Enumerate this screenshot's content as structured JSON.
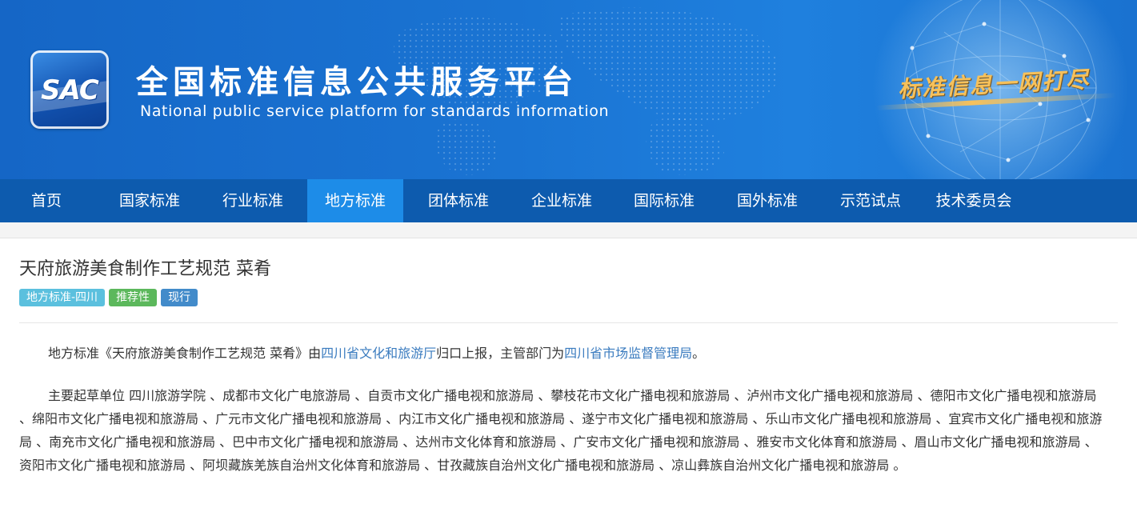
{
  "header": {
    "logo_text": "SAC",
    "title": "全国标准信息公共服务平台",
    "subtitle": "National public service platform  for standards information",
    "slogan": "标准信息一网打尽"
  },
  "nav": {
    "items": [
      {
        "label": "首页"
      },
      {
        "label": "国家标准"
      },
      {
        "label": "行业标准"
      },
      {
        "label": "地方标准"
      },
      {
        "label": "团体标准"
      },
      {
        "label": "企业标准"
      },
      {
        "label": "国际标准"
      },
      {
        "label": "国外标准"
      },
      {
        "label": "示范试点"
      },
      {
        "label": "技术委员会"
      }
    ],
    "active": "地方标准"
  },
  "standard": {
    "title": "天府旅游美食制作工艺规范 菜肴",
    "badges": [
      {
        "label": "地方标准-四川",
        "color": "#5bc0de"
      },
      {
        "label": "推荐性",
        "color": "#5cb85c"
      },
      {
        "label": "现行",
        "color": "#428bca"
      }
    ],
    "summary": {
      "prefix": "地方标准《天府旅游美食制作工艺规范 菜肴》由",
      "reporter": "四川省文化和旅游厅",
      "middle": "归口上报，主管部门为",
      "authority": "四川省市场监督管理局",
      "suffix": "。"
    },
    "drafting_units": "主要起草单位 四川旅游学院 、成都市文化广电旅游局 、自贡市文化广播电视和旅游局 、攀枝花市文化广播电视和旅游局 、泸州市文化广播电视和旅游局 、德阳市文化广播电视和旅游局 、绵阳市文化广播电视和旅游局 、广元市文化广播电视和旅游局 、内江市文化广播电视和旅游局 、遂宁市文化广播电视和旅游局 、乐山市文化广播电视和旅游局 、宜宾市文化广播电视和旅游局 、南充市文化广播电视和旅游局 、巴中市文化广播电视和旅游局 、达州市文化体育和旅游局 、广安市文化广播电视和旅游局 、雅安市文化体育和旅游局 、眉山市文化广播电视和旅游局 、资阳市文化广播电视和旅游局 、阿坝藏族羌族自治州文化体育和旅游局 、甘孜藏族自治州文化广播电视和旅游局 、凉山彝族自治州文化广播电视和旅游局 。"
  }
}
